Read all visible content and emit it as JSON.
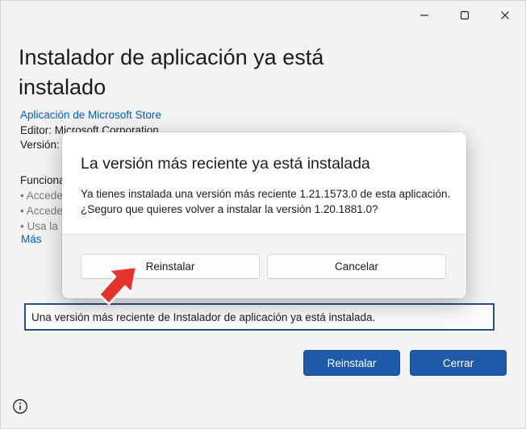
{
  "window": {
    "controls": {
      "minimize_icon": "minimize-icon",
      "maximize_icon": "maximize-icon",
      "close_icon": "close-icon"
    }
  },
  "page": {
    "title": "Instalador de aplicación ya está instalado",
    "publisher_link": "Aplicación de Microsoft Store",
    "editor": "Editor: Microsoft Corporation",
    "version_label": "Versión:",
    "capabilities_heading": "Funciona",
    "capabilities": [
      "Accede",
      "Accede",
      "Usa la"
    ],
    "more_link": "Más",
    "status_message": "Una versión más reciente de Instalador de aplicación ya está instalada.",
    "reinstall_button": "Reinstalar",
    "close_button": "Cerrar",
    "info_icon": "info-icon"
  },
  "dialog": {
    "title": "La versión más reciente ya está instalada",
    "line1": "Ya tienes instalada una versión más reciente 1.21.1573.0 de esta aplicación.",
    "line2": "¿Seguro que quieres volver a instalar la versión 1.20.1881.0?",
    "reinstall_button": "Reinstalar",
    "cancel_button": "Cancelar"
  },
  "colors": {
    "accent": "#1e5aa8",
    "link": "#005fb8",
    "annotation_arrow": "#e8322e"
  }
}
